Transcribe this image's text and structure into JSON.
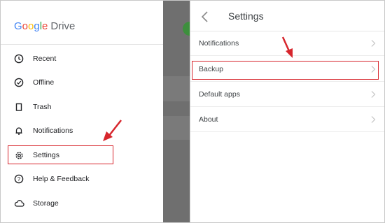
{
  "drawer": {
    "logo": {
      "google": "Google",
      "drive": "Drive"
    },
    "items": [
      {
        "label": "Recent",
        "icon": "clock-icon"
      },
      {
        "label": "Offline",
        "icon": "offline-check-icon"
      },
      {
        "label": "Trash",
        "icon": "trash-icon"
      },
      {
        "label": "Notifications",
        "icon": "bell-icon"
      },
      {
        "label": "Settings",
        "icon": "gear-icon"
      },
      {
        "label": "Help & Feedback",
        "icon": "help-icon"
      },
      {
        "label": "Storage",
        "icon": "cloud-icon"
      }
    ]
  },
  "settings": {
    "title": "Settings",
    "back_icon": "back-chevron-icon",
    "rows": [
      {
        "label": "Notifications"
      },
      {
        "label": "Backup"
      },
      {
        "label": "Default apps"
      },
      {
        "label": "About"
      }
    ]
  },
  "annotations": {
    "highlight_color": "#d7262d"
  }
}
